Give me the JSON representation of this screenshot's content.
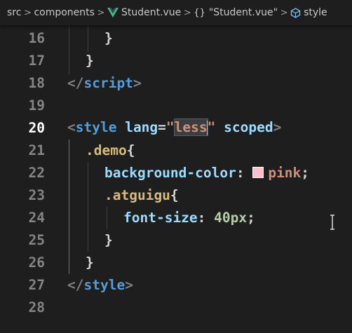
{
  "breadcrumb": {
    "items": [
      "src",
      "components",
      "Student.vue",
      "\"Student.vue\"",
      "style"
    ],
    "icons": [
      "vue-icon",
      "braces-icon",
      "style-icon"
    ]
  },
  "editor": {
    "line_numbers": [
      "16",
      "17",
      "18",
      "19",
      "20",
      "21",
      "22",
      "23",
      "24",
      "25",
      "26",
      "27",
      "28"
    ],
    "active_line": "20",
    "lines": {
      "l16": "}",
      "l17": "}",
      "l18_open": "</",
      "l18_tag": "script",
      "l18_close": ">",
      "l20_lt": "<",
      "l20_tag": "style",
      "l20_attr": "lang",
      "l20_eq": "=",
      "l20_q1": "\"",
      "l20_val": "less",
      "l20_q2": "\"",
      "l20_attr2": "scoped",
      "l20_gt": ">",
      "l21_sel": ".demo",
      "l21_brace": "{",
      "l22_prop": "background-color",
      "l22_colon": ": ",
      "l22_val": "pink",
      "l22_semi": ";",
      "l23_sel": ".atguigu",
      "l23_brace": "{",
      "l24_prop": "font-size",
      "l24_colon": ": ",
      "l24_val": "40px",
      "l24_semi": ";",
      "l25": "}",
      "l26": "}",
      "l27_open": "</",
      "l27_tag": "style",
      "l27_close": ">"
    },
    "swatch_color": "#ffc0cb"
  }
}
